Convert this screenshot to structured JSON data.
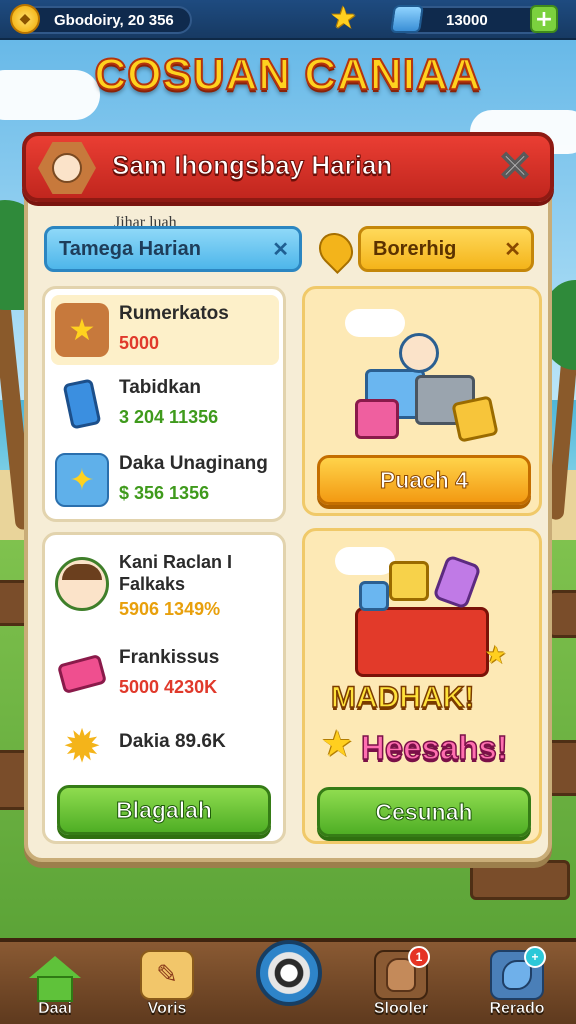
{
  "topbar": {
    "player_label": "Gbodoiry, 20 356",
    "gems_value": "13000",
    "coin_icon": "coin-icon",
    "star_icon": "star-icon",
    "gem_icon": "gem-icon",
    "plus_label": "+"
  },
  "game_title": "COSUAN CANIAA",
  "panel": {
    "title": "Sam Ihongsbay Harian",
    "close_label": "✕",
    "subtab_caption": "Jihar luah",
    "tabs": [
      {
        "label": "Tamega Harian",
        "close": "✕"
      },
      {
        "label": "Borerhig",
        "close": "✕"
      }
    ]
  },
  "left_list_1": [
    {
      "name": "Rumerkatos",
      "value": "5000",
      "value_color": "#e0392b",
      "icon": "star-icon"
    },
    {
      "name": "Tabidkan",
      "value": "3 204 11356",
      "value_color": "#3f9a1c",
      "icon": "phone-icon"
    },
    {
      "name": "Daka Unaginang",
      "value": "$ 356 1356",
      "value_color": "#3f9a1c",
      "icon": "gift-icon"
    }
  ],
  "left_list_2": [
    {
      "name": "Kani Raclan I Falkaks",
      "value": "5906 1349%",
      "value_color": "#e8a00c",
      "icon": "character-icon"
    },
    {
      "name": "Frankissus",
      "value": "5000 4230K",
      "value_color": "#e0392b",
      "icon": "ticket-icon"
    },
    {
      "name": "Dakia 89.6K",
      "value": "",
      "value_color": "#2b2b2b",
      "icon": "sun-badge-icon"
    }
  ],
  "buttons": {
    "puach": "Puach 4",
    "blagakah": "Blagalah",
    "cesunah": "Cesunah"
  },
  "promo": {
    "line1": "MADHAK!",
    "line2": "Heesahs!"
  },
  "nav": [
    {
      "label": "Daai",
      "icon": "home-icon",
      "badge": ""
    },
    {
      "label": "Voris",
      "icon": "map-icon",
      "badge": ""
    },
    {
      "label": "Slooler",
      "icon": "bag-icon",
      "badge": "1"
    },
    {
      "label": "Rerado",
      "icon": "puzzle-icon",
      "badge": "+"
    }
  ],
  "colors": {
    "header_red": "#d32f25",
    "panel_bg": "#f6edd6",
    "accent_orange": "#f39a12",
    "accent_green": "#4fae25",
    "tab_blue": "#4eb6ea"
  }
}
